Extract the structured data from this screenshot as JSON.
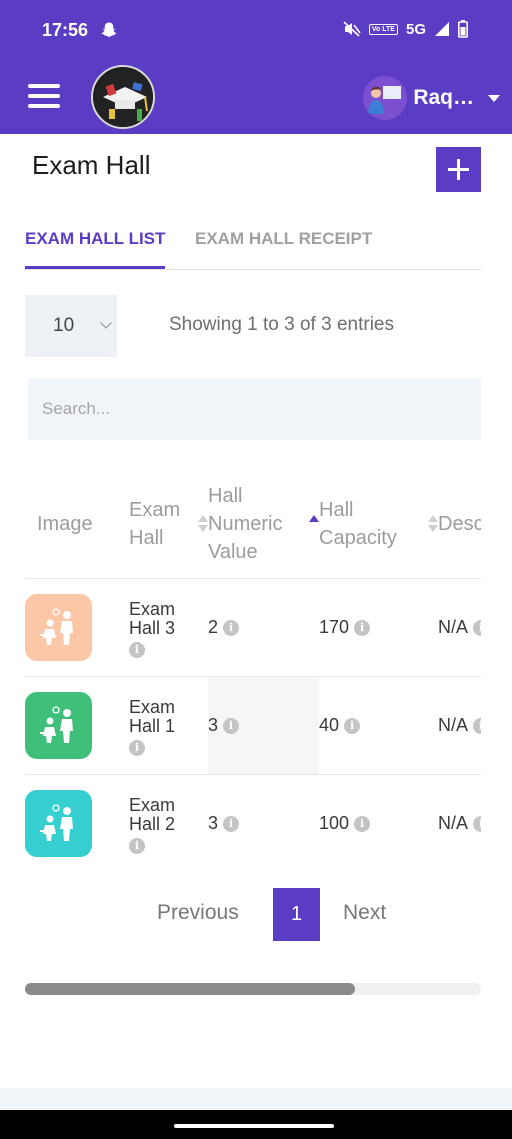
{
  "status_bar": {
    "time": "17:56",
    "network": "5G",
    "volte": "Vo LTE"
  },
  "header": {
    "user_name": "Raq…"
  },
  "page": {
    "title": "Exam Hall"
  },
  "tabs": [
    {
      "label": "EXAM HALL LIST",
      "active": true
    },
    {
      "label": "EXAM HALL RECEIPT",
      "active": false
    }
  ],
  "table_controls": {
    "page_length": "10",
    "entries_info": "Showing 1 to 3 of 3 entries",
    "search_placeholder": "Search..."
  },
  "table": {
    "columns": [
      "Image",
      "Exam Hall",
      "Hall Numeric Value",
      "Hall Capacity",
      "Description"
    ],
    "rows": [
      {
        "image_color": "#fcc7a6",
        "exam_hall": "Exam Hall 3",
        "numeric_value": "2",
        "capacity": "170",
        "description": "N/A"
      },
      {
        "image_color": "#3ec07a",
        "exam_hall": "Exam Hall 1",
        "numeric_value": "3",
        "capacity": "40",
        "description": "N/A"
      },
      {
        "image_color": "#35cfcf",
        "exam_hall": "Exam Hall 2",
        "numeric_value": "3",
        "capacity": "100",
        "description": "N/A"
      }
    ]
  },
  "pagination": {
    "previous": "Previous",
    "current_page": "1",
    "next": "Next"
  },
  "colors": {
    "brand": "#5b3cc4",
    "accent_text": "#5b3cc4"
  }
}
